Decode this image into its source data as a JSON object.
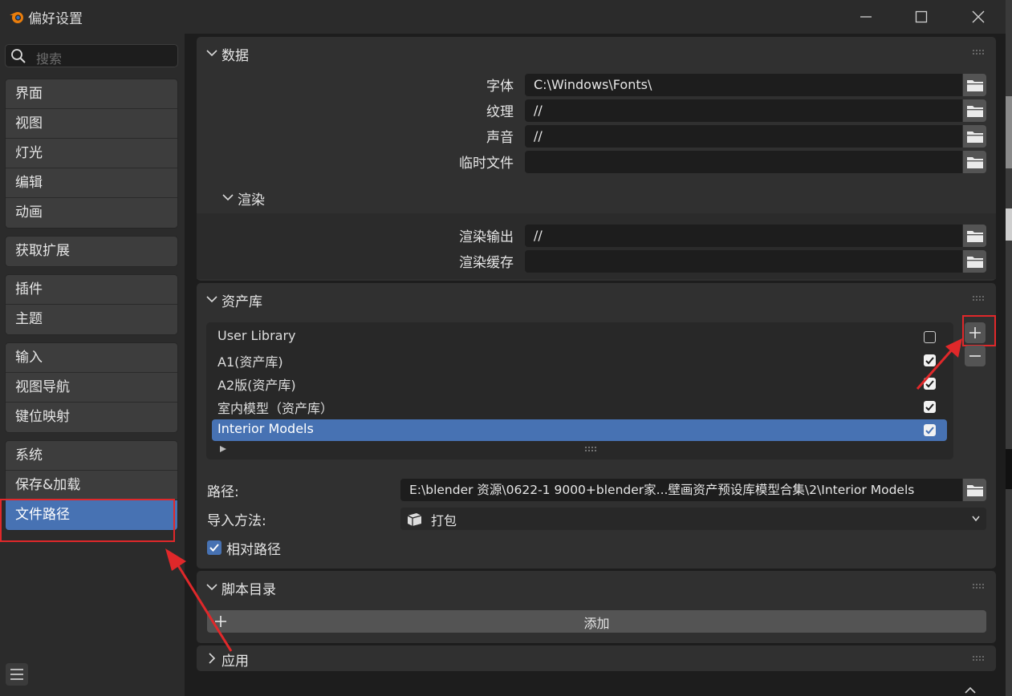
{
  "window": {
    "title": "偏好设置"
  },
  "sidebar": {
    "search_placeholder": "搜索",
    "groups": [
      [
        "界面",
        "视图",
        "灯光",
        "编辑",
        "动画"
      ],
      [
        "获取扩展"
      ],
      [
        "插件",
        "主题"
      ],
      [
        "输入",
        "视图导航",
        "键位映射"
      ],
      [
        "系统",
        "保存&加载",
        "文件路径"
      ]
    ],
    "active": "文件路径"
  },
  "data_panel": {
    "title": "数据",
    "fields": [
      {
        "label": "字体",
        "value": "C:\\Windows\\Fonts\\"
      },
      {
        "label": "纹理",
        "value": "//"
      },
      {
        "label": "声音",
        "value": "//"
      },
      {
        "label": "临时文件",
        "value": ""
      }
    ],
    "render": {
      "title": "渲染",
      "fields": [
        {
          "label": "渲染输出",
          "value": "//"
        },
        {
          "label": "渲染缓存",
          "value": ""
        }
      ]
    }
  },
  "asset_panel": {
    "title": "资产库",
    "libraries": [
      {
        "name": "User Library",
        "enabled": false
      },
      {
        "name": "A1(资产库)",
        "enabled": true
      },
      {
        "name": "A2版(资产库)",
        "enabled": true
      },
      {
        "name": "室内模型（资产库）",
        "enabled": true
      },
      {
        "name": "Interior Models",
        "enabled": true,
        "selected": true
      }
    ],
    "path_label": "路径:",
    "path_value": "E:\\blender 资源\\0622-1 9000+blender家...壁画资产预设库模型合集\\2\\Interior Models",
    "import_label": "导入方法:",
    "import_value": "打包",
    "relative_label": "相对路径",
    "relative_checked": true
  },
  "script_panel": {
    "title": "脚本目录",
    "add_label": "添加"
  },
  "apply_panel": {
    "title": "应用"
  },
  "colors": {
    "accent": "#4772b3",
    "highlight": "#e0282a"
  }
}
